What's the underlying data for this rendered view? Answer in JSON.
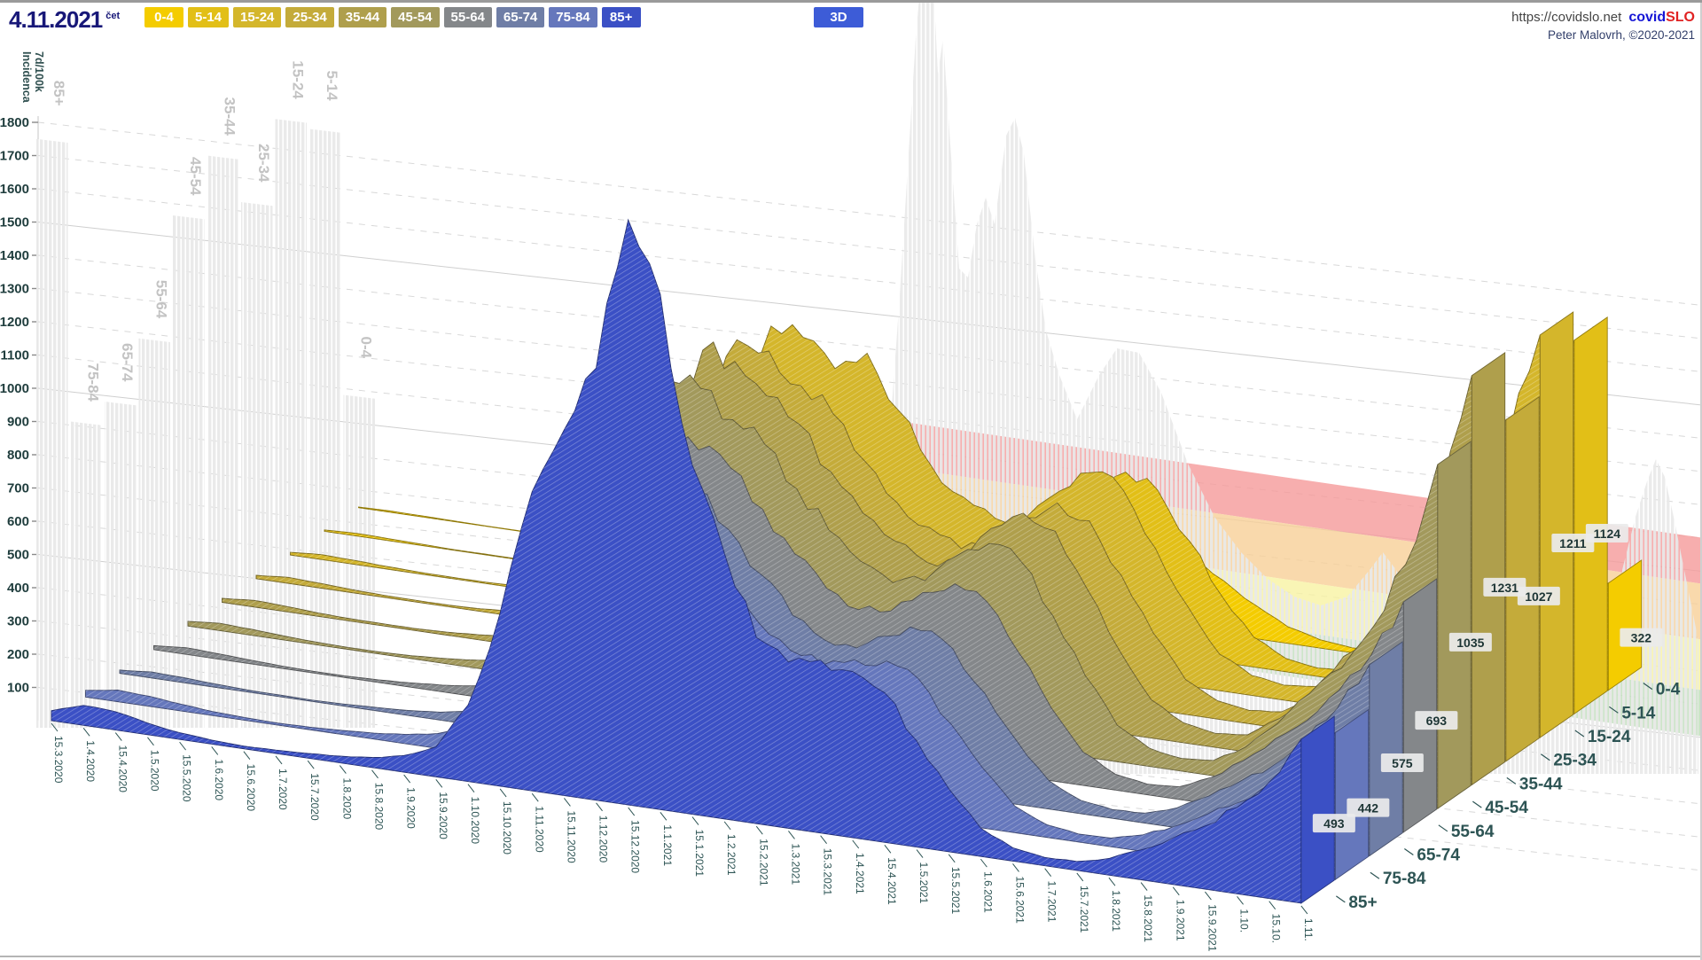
{
  "header": {
    "date": "4.11.2021",
    "weekday": "čet",
    "mode_button": "3D",
    "url": "https://covidslo.net",
    "logo": {
      "covid": "covid",
      "slo": "SLO"
    },
    "credit": "Peter Malovrh, ©2020-2021",
    "age_buttons": [
      {
        "label": "0-4",
        "color": "#F4CC00"
      },
      {
        "label": "5-14",
        "color": "#E2BF17"
      },
      {
        "label": "15-24",
        "color": "#D4B62B"
      },
      {
        "label": "25-34",
        "color": "#C4AB3A"
      },
      {
        "label": "35-44",
        "color": "#AF9F4C"
      },
      {
        "label": "45-54",
        "color": "#A2995C"
      },
      {
        "label": "55-64",
        "color": "#84878A"
      },
      {
        "label": "65-74",
        "color": "#6F7EA6"
      },
      {
        "label": "75-84",
        "color": "#6577BC"
      },
      {
        "label": "85+",
        "color": "#3B50C5"
      }
    ]
  },
  "chart_data": {
    "type": "area",
    "variant": "3d-ridge-waterfall",
    "ylabel_line1": "7d/100k",
    "ylabel_line2": "Incidenca",
    "ylim": [
      0,
      1800
    ],
    "y_tick_step": 100,
    "grid": "on",
    "x": [
      "15.3.2020",
      "1.4.2020",
      "15.4.2020",
      "1.5.2020",
      "15.5.2020",
      "1.6.2020",
      "15.6.2020",
      "1.7.2020",
      "15.7.2020",
      "1.8.2020",
      "15.8.2020",
      "1.9.2020",
      "15.9.2020",
      "1.10.2020",
      "15.10.2020",
      "1.11.2020",
      "15.11.2020",
      "1.12.2020",
      "15.12.2020",
      "1.1.2021",
      "15.1.2021",
      "1.2.2021",
      "15.2.2021",
      "1.3.2021",
      "15.3.2021",
      "1.4.2021",
      "15.4.2021",
      "1.5.2021",
      "15.5.2021",
      "1.6.2021",
      "15.6.2021",
      "1.7.2021",
      "15.7.2021",
      "1.8.2021",
      "15.8.2021",
      "1.9.2021",
      "15.9.2021",
      "1.10.",
      "15.10.",
      "1.11."
    ],
    "series": [
      {
        "name": "0-4",
        "color": "#F4CC00",
        "wall_max": 980,
        "values": [
          2,
          4,
          3,
          2,
          1,
          1,
          1,
          2,
          3,
          5,
          8,
          12,
          25,
          60,
          150,
          260,
          300,
          290,
          270,
          235,
          205,
          185,
          165,
          175,
          205,
          240,
          220,
          160,
          100,
          50,
          25,
          15,
          18,
          40,
          80,
          120,
          160,
          200,
          260,
          322
        ]
      },
      {
        "name": "5-14",
        "color": "#E2BF17",
        "wall_max": 1780,
        "values": [
          4,
          8,
          6,
          4,
          2,
          2,
          2,
          3,
          5,
          8,
          12,
          20,
          45,
          120,
          330,
          520,
          560,
          520,
          480,
          400,
          340,
          310,
          290,
          330,
          430,
          530,
          490,
          350,
          200,
          90,
          40,
          25,
          30,
          70,
          150,
          260,
          380,
          560,
          820,
          1124
        ]
      },
      {
        "name": "15-24",
        "color": "#D4B62B",
        "wall_max": 1810,
        "values": [
          8,
          15,
          12,
          8,
          5,
          4,
          4,
          6,
          10,
          18,
          30,
          60,
          120,
          280,
          650,
          900,
          880,
          800,
          860,
          700,
          550,
          470,
          420,
          440,
          530,
          600,
          560,
          400,
          240,
          110,
          60,
          45,
          55,
          120,
          220,
          340,
          440,
          620,
          880,
          1211
        ]
      },
      {
        "name": "25-34",
        "color": "#C4AB3A",
        "wall_max": 1560,
        "values": [
          10,
          18,
          14,
          9,
          6,
          5,
          5,
          8,
          14,
          22,
          35,
          65,
          130,
          300,
          680,
          930,
          910,
          820,
          750,
          620,
          510,
          450,
          400,
          430,
          520,
          580,
          540,
          390,
          230,
          105,
          55,
          40,
          50,
          110,
          200,
          310,
          400,
          560,
          780,
          1027
        ]
      },
      {
        "name": "35-44",
        "color": "#AF9F4C",
        "wall_max": 1700,
        "values": [
          12,
          20,
          16,
          10,
          7,
          6,
          6,
          9,
          15,
          24,
          38,
          70,
          140,
          320,
          720,
          970,
          950,
          860,
          790,
          660,
          550,
          480,
          430,
          460,
          560,
          620,
          580,
          420,
          250,
          115,
          60,
          42,
          52,
          115,
          210,
          330,
          430,
          600,
          840,
          1231
        ]
      },
      {
        "name": "45-54",
        "color": "#A2995C",
        "wall_max": 1520,
        "values": [
          14,
          22,
          18,
          12,
          8,
          6,
          6,
          9,
          15,
          24,
          38,
          68,
          135,
          310,
          700,
          950,
          940,
          860,
          800,
          680,
          570,
          490,
          440,
          460,
          550,
          600,
          560,
          410,
          245,
          110,
          55,
          38,
          46,
          100,
          185,
          290,
          380,
          520,
          720,
          1035
        ]
      },
      {
        "name": "55-64",
        "color": "#84878A",
        "wall_max": 1150,
        "values": [
          12,
          20,
          16,
          11,
          7,
          5,
          5,
          8,
          13,
          20,
          32,
          55,
          110,
          260,
          620,
          850,
          880,
          840,
          800,
          690,
          570,
          480,
          430,
          440,
          510,
          550,
          510,
          370,
          220,
          100,
          48,
          32,
          38,
          80,
          145,
          225,
          295,
          400,
          520,
          693
        ]
      },
      {
        "name": "65-74",
        "color": "#6F7EA6",
        "wall_max": 960,
        "values": [
          10,
          18,
          15,
          10,
          6,
          5,
          4,
          6,
          10,
          15,
          24,
          40,
          80,
          200,
          480,
          700,
          760,
          780,
          800,
          700,
          580,
          470,
          410,
          400,
          450,
          480,
          440,
          320,
          190,
          85,
          40,
          26,
          30,
          60,
          110,
          170,
          230,
          320,
          430,
          575
        ]
      },
      {
        "name": "75-84",
        "color": "#6577BC",
        "wall_max": 900,
        "values": [
          20,
          35,
          30,
          20,
          12,
          8,
          6,
          8,
          12,
          18,
          28,
          45,
          85,
          210,
          480,
          720,
          800,
          820,
          840,
          760,
          640,
          520,
          450,
          420,
          450,
          460,
          420,
          300,
          180,
          80,
          38,
          24,
          26,
          50,
          90,
          140,
          190,
          260,
          340,
          442
        ]
      },
      {
        "name": "85+",
        "color": "#3B50C5",
        "wall_max": 1750,
        "values": [
          30,
          60,
          55,
          35,
          20,
          12,
          8,
          10,
          14,
          20,
          30,
          50,
          90,
          230,
          520,
          900,
          1100,
          1300,
          1760,
          1550,
          1050,
          800,
          560,
          500,
          520,
          500,
          450,
          320,
          190,
          85,
          40,
          25,
          27,
          50,
          90,
          140,
          190,
          260,
          350,
          493
        ]
      }
    ],
    "threshold_bands": [
      {
        "name": "red",
        "color": "#F59A9A"
      },
      {
        "name": "orange",
        "color": "#F7CF97"
      },
      {
        "name": "yellow",
        "color": "#F7F3A2"
      },
      {
        "name": "green",
        "color": "#BFDFBA"
      }
    ]
  }
}
